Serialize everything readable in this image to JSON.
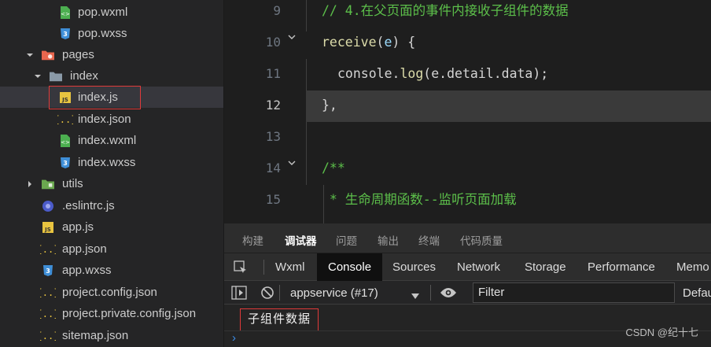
{
  "sidebar": {
    "items": [
      {
        "label": "pop.wxml",
        "icon": "wxml-file-icon",
        "depth": 2
      },
      {
        "label": "pop.wxss",
        "icon": "wxss-file-icon",
        "depth": 2
      },
      {
        "label": "pages",
        "icon": "folder-icon",
        "depth": 0,
        "expanded": true
      },
      {
        "label": "index",
        "icon": "folder-icon",
        "depth": 1,
        "expanded": true
      },
      {
        "label": "index.js",
        "icon": "js-file-icon",
        "depth": 2,
        "selected": true
      },
      {
        "label": "index.json",
        "icon": "json-file-icon",
        "depth": 2
      },
      {
        "label": "index.wxml",
        "icon": "wxml-file-icon",
        "depth": 2
      },
      {
        "label": "index.wxss",
        "icon": "wxss-file-icon",
        "depth": 2
      },
      {
        "label": "utils",
        "icon": "folder-icon",
        "depth": 0,
        "expanded": false
      },
      {
        "label": ".eslintrc.js",
        "icon": "eslint-file-icon",
        "depth": 0
      },
      {
        "label": "app.js",
        "icon": "js-file-icon",
        "depth": 0
      },
      {
        "label": "app.json",
        "icon": "json-file-icon",
        "depth": 0
      },
      {
        "label": "app.wxss",
        "icon": "wxss-file-icon",
        "depth": 0
      },
      {
        "label": "project.config.json",
        "icon": "json-file-icon",
        "depth": 0
      },
      {
        "label": "project.private.config.json",
        "icon": "json-file-icon",
        "depth": 0
      },
      {
        "label": "sitemap.json",
        "icon": "json-file-icon",
        "depth": 0
      }
    ]
  },
  "editor": {
    "lines": [
      {
        "number": "9",
        "comment": "// 4.在父页面的事件内接收子组件的数据"
      },
      {
        "number": "10",
        "fn": "receive",
        "open": "(",
        "param": "e",
        "close": ") {"
      },
      {
        "number": "11",
        "text": "console.",
        "fn": "log",
        "args": "(e.detail.data);"
      },
      {
        "number": "12",
        "text": "},",
        "active": true
      },
      {
        "number": "13",
        "text": ""
      },
      {
        "number": "14",
        "comment": "/**"
      },
      {
        "number": "15",
        "comment": " * 生命周期函数--监听页面加载"
      }
    ]
  },
  "panel": {
    "tabs": [
      "构建",
      "调试器",
      "问题",
      "输出",
      "终端",
      "代码质量"
    ],
    "active_tab": "调试器",
    "devtools_tabs": [
      "Wxml",
      "Console",
      "Sources",
      "Network",
      "Storage",
      "Performance",
      "Memo"
    ],
    "active_devtools_tab": "Console",
    "context": "appservice (#17)",
    "filter_placeholder": "Filter",
    "levels": "Defau",
    "log_output": "子组件数据",
    "prompt": "›"
  },
  "watermark": "CSDN @纪十七",
  "colors": {
    "highlight_border": "#e03a3a",
    "comment": "#5cbf4a",
    "function": "#dcdcaa",
    "param": "#9cdcfe",
    "prompt": "#3b8eea"
  }
}
